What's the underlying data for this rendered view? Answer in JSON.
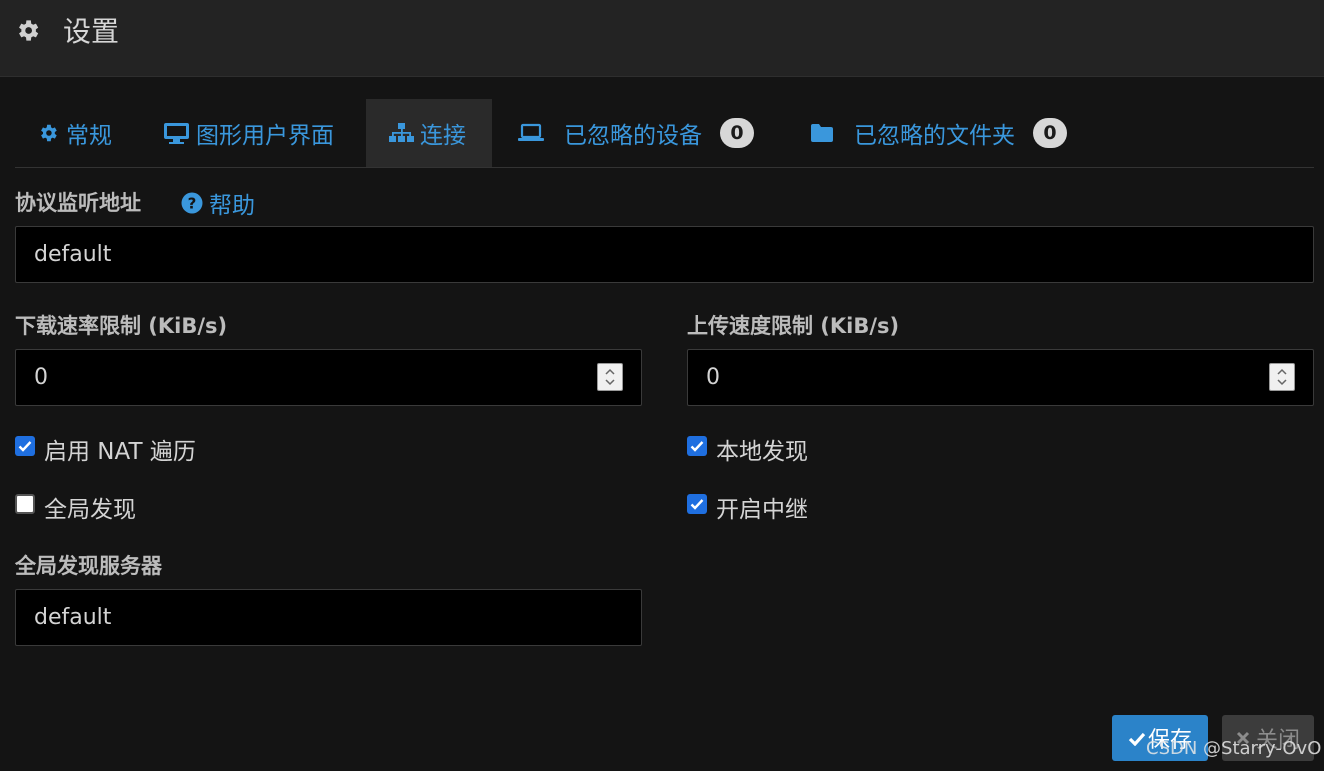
{
  "header": {
    "title": "设置"
  },
  "tabs": [
    {
      "label": "常规",
      "icon": "gear-icon"
    },
    {
      "label": "图形用户界面",
      "icon": "monitor-icon"
    },
    {
      "label": "连接",
      "icon": "sitemap-icon",
      "active": true
    },
    {
      "label": "已忽略的设备",
      "icon": "laptop-icon",
      "badge": "0"
    },
    {
      "label": "已忽略的文件夹",
      "icon": "folder-icon",
      "badge": "0"
    }
  ],
  "listen": {
    "label": "协议监听地址",
    "help": "帮助",
    "value": "default"
  },
  "download": {
    "label": "下载速率限制 (KiB/s)",
    "value": "0"
  },
  "upload": {
    "label": "上传速度限制 (KiB/s)",
    "value": "0"
  },
  "checkboxes": {
    "nat": {
      "label": "启用 NAT 遍历",
      "checked": true
    },
    "local": {
      "label": "本地发现",
      "checked": true
    },
    "global": {
      "label": "全局发现",
      "checked": false
    },
    "relay": {
      "label": "开启中继",
      "checked": true
    }
  },
  "global_server": {
    "label": "全局发现服务器",
    "value": "default"
  },
  "buttons": {
    "save": "保存",
    "close": "关闭"
  },
  "watermark": "CSDN @Starry-OvO",
  "colors": {
    "accent": "#3a97dc",
    "checkbox": "#1f6fe0",
    "save_button": "#2b83c9"
  }
}
